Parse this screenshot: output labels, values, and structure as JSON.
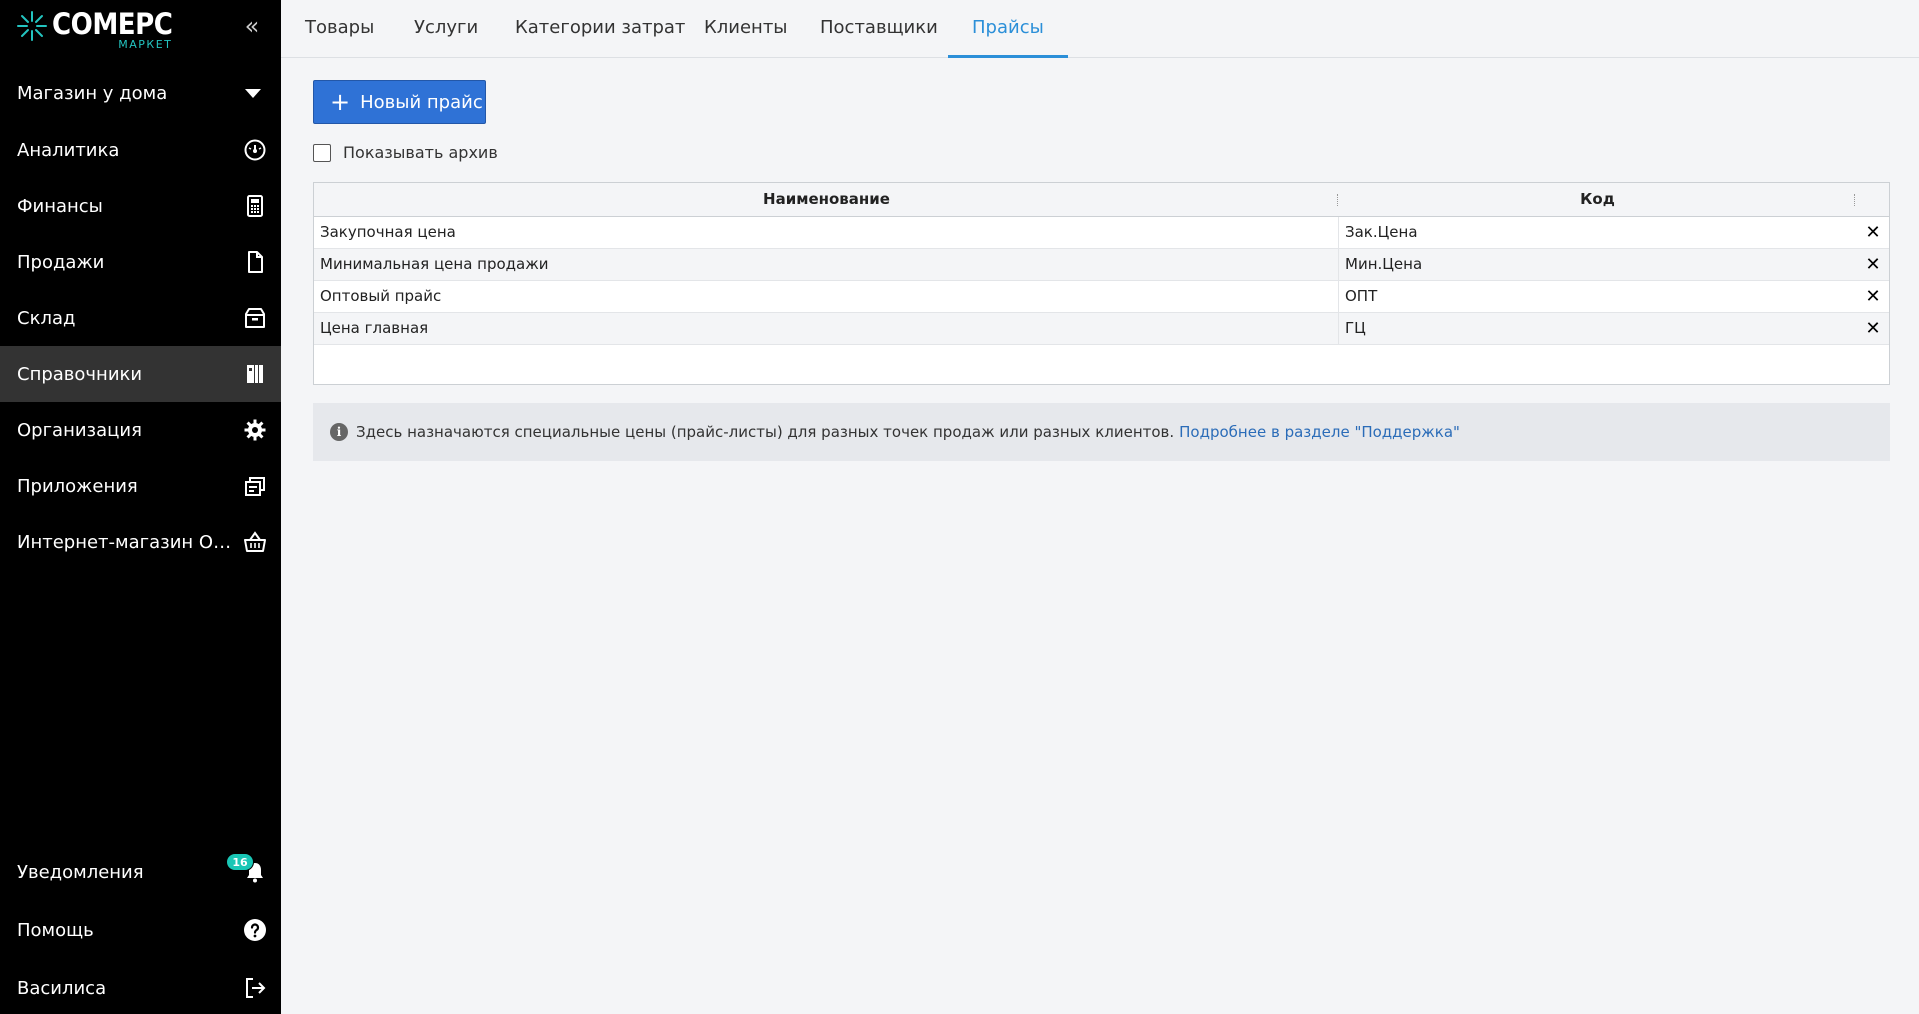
{
  "app": {
    "logo_main": "COMEPC",
    "logo_sub": "МАРКЕТ"
  },
  "sidebar": {
    "store_name": "Магазин у дома",
    "items": [
      {
        "label": "Аналитика",
        "icon": "gauge-icon"
      },
      {
        "label": "Финансы",
        "icon": "calculator-icon"
      },
      {
        "label": "Продажи",
        "icon": "document-icon"
      },
      {
        "label": "Склад",
        "icon": "box-icon"
      },
      {
        "label": "Справочники",
        "icon": "books-icon",
        "active": true
      },
      {
        "label": "Организация",
        "icon": "gear-icon"
      },
      {
        "label": "Приложения",
        "icon": "windows-icon"
      },
      {
        "label": "Интернет-магазин Opencart",
        "icon": "basket-icon"
      }
    ],
    "bottom": {
      "notifications": {
        "label": "Уведомления",
        "count": "16",
        "icon": "bell-icon"
      },
      "help": {
        "label": "Помощь",
        "icon": "help-icon"
      },
      "user": {
        "label": "Василиса",
        "icon": "logout-icon"
      }
    }
  },
  "tabs": [
    {
      "label": "Товары"
    },
    {
      "label": "Услуги"
    },
    {
      "label": "Категории затрат"
    },
    {
      "label": "Клиенты"
    },
    {
      "label": "Поставщики"
    },
    {
      "label": "Прайсы",
      "active": true
    }
  ],
  "toolbar": {
    "new_button_label": "Новый прайс",
    "show_archive_label": "Показывать архив",
    "show_archive_checked": false
  },
  "grid": {
    "columns": [
      "Наименование",
      "Код"
    ],
    "rows": [
      {
        "name": "Закупочная цена",
        "code": "Зак.Цена"
      },
      {
        "name": "Минимальная цена продажи",
        "code": "Мин.Цена"
      },
      {
        "name": "Оптовый прайс",
        "code": "ОПТ"
      },
      {
        "name": "Цена главная",
        "code": "ГЦ"
      }
    ]
  },
  "info": {
    "text": "Здесь назначаются специальные цены (прайс-листы) для разных точек продаж или разных клиентов.",
    "link": "Подробнее в разделе \"Поддержка\""
  },
  "colors": {
    "accent": "#2b8fd8",
    "button": "#2f72d6",
    "badge": "#19c6b5",
    "sidebar_bg": "#000000",
    "sidebar_active": "#333333"
  }
}
